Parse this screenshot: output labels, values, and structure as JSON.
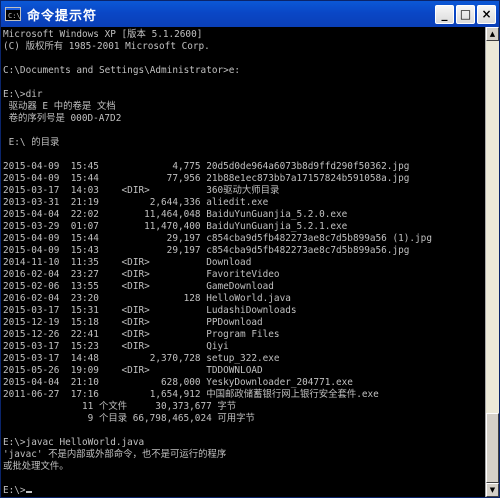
{
  "window": {
    "title": "命令提示符",
    "minimize_label": "_",
    "maximize_label": "□",
    "close_label": "×"
  },
  "console": {
    "lines": [
      "Microsoft Windows XP [版本 5.1.2600]",
      "(C) 版权所有 1985-2001 Microsoft Corp.",
      "",
      "C:\\Documents and Settings\\Administrator>e:",
      "",
      "E:\\>dir",
      " 驱动器 E 中的卷是 文档",
      " 卷的序列号是 000D-A7D2",
      "",
      " E:\\ 的目录",
      "",
      "2015-04-09  15:45             4,775 20d5d0de964a6073b8d9ffd290f50362.jpg",
      "2015-04-09  15:44            77,956 21b88e1ec873bb7a17157824b591058a.jpg",
      "2015-03-17  14:03    <DIR>          360驱动大师目录",
      "2013-03-31  21:19         2,644,336 aliedit.exe",
      "2015-04-04  22:02        11,464,048 BaiduYunGuanjia_5.2.0.exe",
      "2015-03-29  01:07        11,470,400 BaiduYunGuanjia_5.2.1.exe",
      "2015-04-09  15:44            29,197 c854cba9d5fb482273ae8c7d5b899a56 (1).jpg",
      "2015-04-09  15:43            29,197 c854cba9d5fb482273ae8c7d5b899a56.jpg",
      "2014-11-10  11:35    <DIR>          Download",
      "2016-02-04  23:27    <DIR>          FavoriteVideo",
      "2015-02-06  13:55    <DIR>          GameDownload",
      "2016-02-04  23:20               128 HelloWorld.java",
      "2015-03-17  15:31    <DIR>          LudashiDownloads",
      "2015-12-19  15:18    <DIR>          PPDownload",
      "2015-12-26  22:41    <DIR>          Program Files",
      "2015-03-17  15:23    <DIR>          Qiyi",
      "2015-03-17  14:48         2,370,728 setup_322.exe",
      "2015-05-26  19:09    <DIR>          TDDOWNLOAD",
      "2015-04-04  21:10           628,000 YeskyDownloader_204771.exe",
      "2011-06-27  17:16         1,654,912 中国邮政储蓄银行网上银行安全套件.exe",
      "              11 个文件     30,373,677 字节",
      "               9 个目录 66,798,465,024 可用字节",
      "",
      "E:\\>javac HelloWorld.java",
      "'javac' 不是内部或外部命令，也不是可运行的程序",
      "或批处理文件。",
      "",
      "E:\\>"
    ]
  }
}
